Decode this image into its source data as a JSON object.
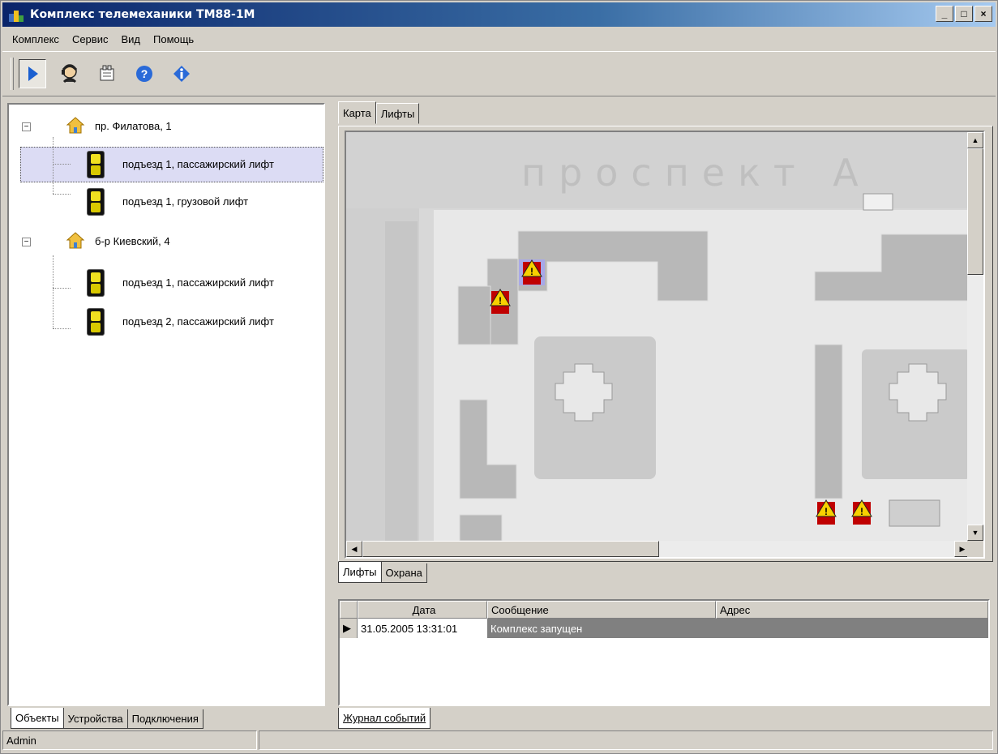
{
  "window": {
    "title": "Комплекс телемеханики ТМ88-1М",
    "btn_minimize": "_",
    "btn_maximize": "□",
    "btn_close": "×"
  },
  "menu": [
    "Комплекс",
    "Сервис",
    "Вид",
    "Помощь"
  ],
  "toolbar": [
    "pointer-icon",
    "operator-icon",
    "network-icon",
    "help-icon",
    "info-icon"
  ],
  "tree": {
    "groups": [
      {
        "label": "пр. Филатова, 1",
        "expander": "−",
        "items": [
          "подъезд 1, пассажирский лифт",
          "подъезд 1, грузовой лифт"
        ]
      },
      {
        "label": "б-р Киевский, 4",
        "expander": "−",
        "items": [
          "подъезд 1, пассажирский лифт",
          "подъезд 2, пассажирский лифт"
        ]
      }
    ],
    "selected": "подъезд 1, пассажирский лифт"
  },
  "left_tabs": [
    "Объекты",
    "Устройства",
    "Подключения"
  ],
  "top_tabs": [
    "Карта",
    "Лифты"
  ],
  "map": {
    "street_label": "проспект А"
  },
  "map_tabs": [
    "Лифты",
    "Охрана"
  ],
  "events": {
    "columns": [
      "Дата",
      "Сообщение",
      "Адрес"
    ],
    "rows": [
      {
        "date": "31.05.2005 13:31:01",
        "message": "Комплекс запущен",
        "address": ""
      }
    ]
  },
  "events_tab": "Журнал событий",
  "status": {
    "user": "Admin"
  },
  "colors": {
    "titlebar": "#0a246a",
    "selected_row": "#dcdcf4",
    "event_row": "#808080"
  }
}
